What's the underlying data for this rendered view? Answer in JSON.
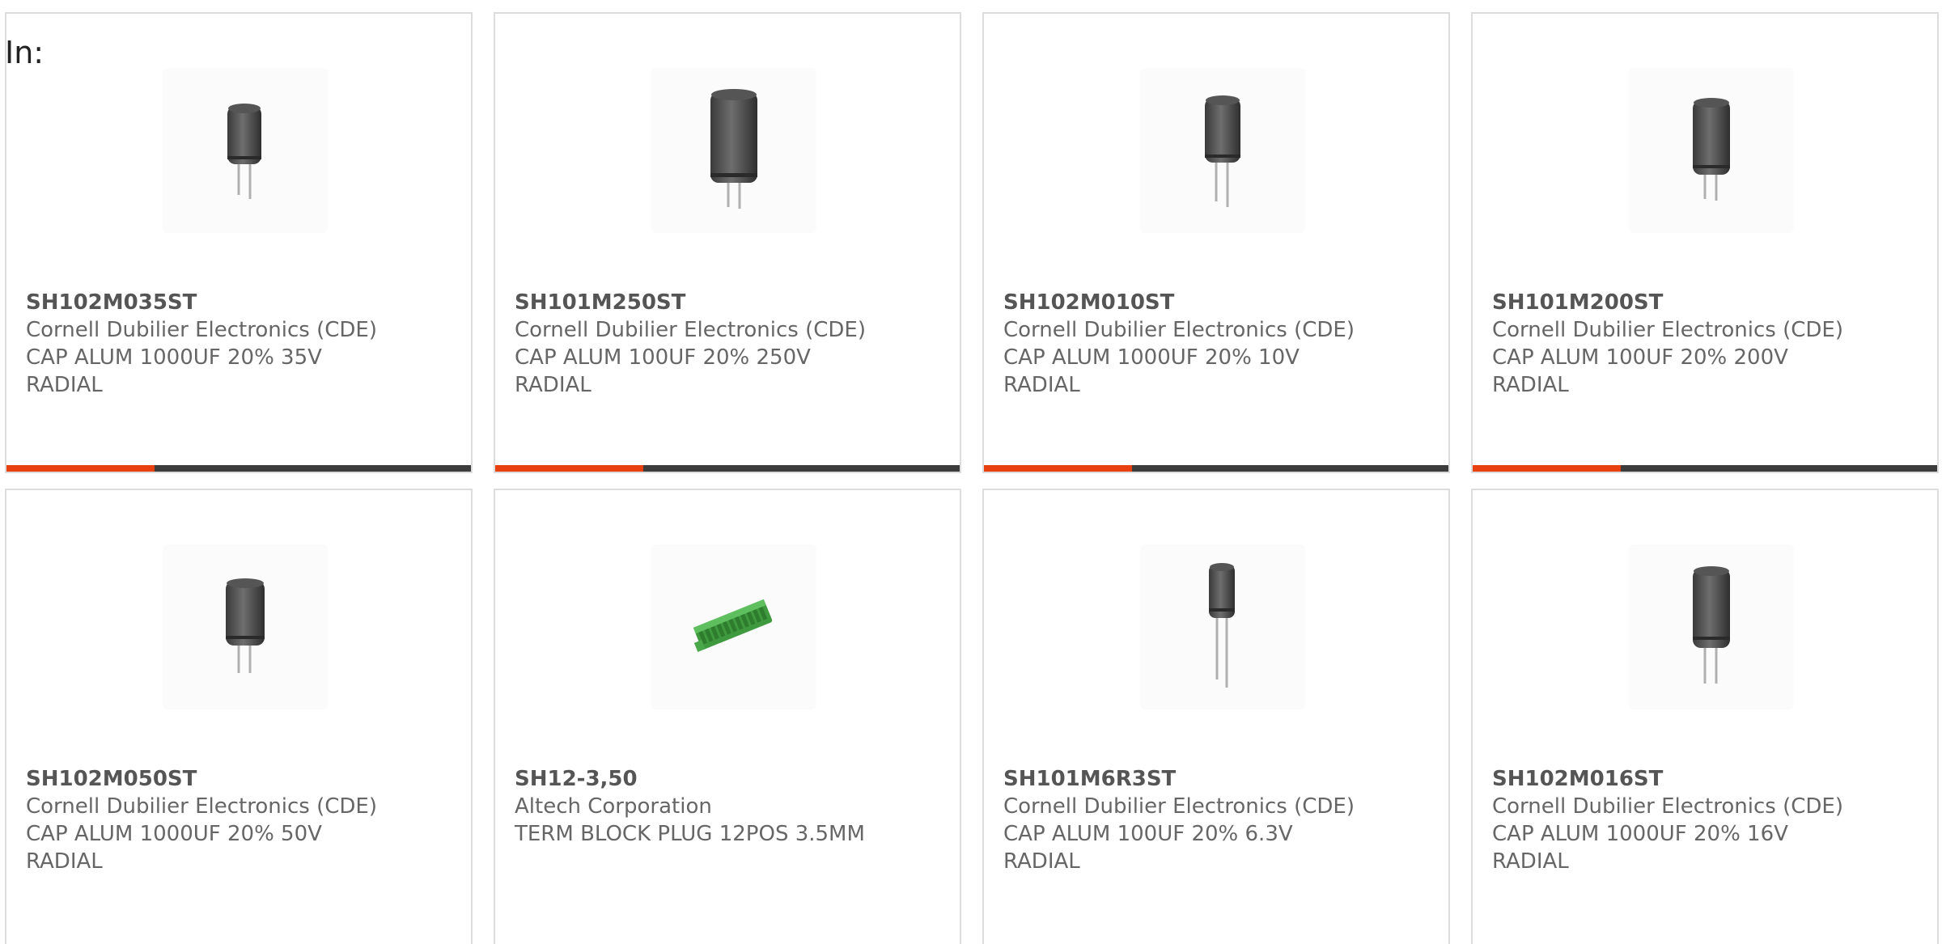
{
  "header": {
    "filter_label": "In:"
  },
  "colors": {
    "accent": "#e8410f",
    "bar": "#3c3c3c",
    "border": "#dcdcdc",
    "text": "#666666"
  },
  "products": [
    {
      "part_number": "SH102M035ST",
      "manufacturer": "Cornell Dubilier Electronics (CDE)",
      "description_line1": "CAP ALUM 1000UF 20% 35V",
      "description_line2": "RADIAL",
      "image": "capacitor-icon"
    },
    {
      "part_number": "SH101M250ST",
      "manufacturer": "Cornell Dubilier Electronics (CDE)",
      "description_line1": "CAP ALUM 100UF 20% 250V",
      "description_line2": "RADIAL",
      "image": "capacitor-icon"
    },
    {
      "part_number": "SH102M010ST",
      "manufacturer": "Cornell Dubilier Electronics (CDE)",
      "description_line1": "CAP ALUM 1000UF 20% 10V",
      "description_line2": "RADIAL",
      "image": "capacitor-icon"
    },
    {
      "part_number": "SH101M200ST",
      "manufacturer": "Cornell Dubilier Electronics (CDE)",
      "description_line1": "CAP ALUM 100UF 20% 200V",
      "description_line2": "RADIAL",
      "image": "capacitor-icon"
    },
    {
      "part_number": "SH102M050ST",
      "manufacturer": "Cornell Dubilier Electronics (CDE)",
      "description_line1": "CAP ALUM 1000UF 20% 50V",
      "description_line2": "RADIAL",
      "image": "capacitor-icon"
    },
    {
      "part_number": "SH12-3,50",
      "manufacturer": "Altech Corporation",
      "description_line1": "TERM BLOCK PLUG 12POS 3.5MM",
      "description_line2": "",
      "image": "terminal-block-icon"
    },
    {
      "part_number": "SH101M6R3ST",
      "manufacturer": "Cornell Dubilier Electronics (CDE)",
      "description_line1": "CAP ALUM 100UF 20% 6.3V",
      "description_line2": "RADIAL",
      "image": "capacitor-icon"
    },
    {
      "part_number": "SH102M016ST",
      "manufacturer": "Cornell Dubilier Electronics (CDE)",
      "description_line1": "CAP ALUM 1000UF 20% 16V",
      "description_line2": "RADIAL",
      "image": "capacitor-icon"
    }
  ]
}
